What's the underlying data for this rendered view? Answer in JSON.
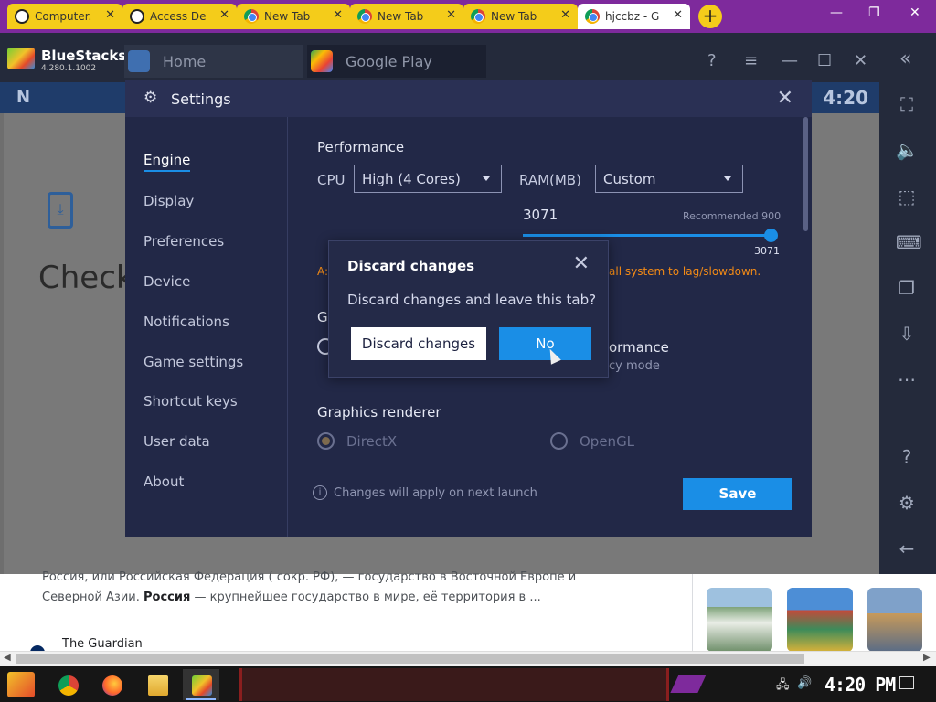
{
  "browser": {
    "tabs": [
      {
        "title": "Computer...",
        "icon": "vpn-icon"
      },
      {
        "title": "Access De",
        "icon": "vpn-icon"
      },
      {
        "title": "New Tab",
        "icon": "chrome-icon"
      },
      {
        "title": "New Tab",
        "icon": "chrome-icon"
      },
      {
        "title": "New Tab",
        "icon": "chrome-icon"
      },
      {
        "title": "hjccbz - G",
        "icon": "chrome-icon",
        "active": true
      }
    ],
    "new_tab": "+",
    "close_glyph": "✕",
    "window_controls": {
      "minimize": "—",
      "restore": "❐",
      "close": "✕"
    }
  },
  "bluestacks": {
    "brand": "BlueStacks",
    "version": "4.280.1.1002",
    "tabs": {
      "home": "Home",
      "google_play": "Google Play"
    },
    "topbar_controls": {
      "help": "?",
      "menu": "≡",
      "minimize": "—",
      "maximize": "☐",
      "close": "✕",
      "collapse": "«"
    }
  },
  "android": {
    "logo": "N",
    "clock": "4:20",
    "heading": "Check"
  },
  "settings": {
    "title": "Settings",
    "close": "✕",
    "nav": [
      "Engine",
      "Display",
      "Preferences",
      "Device",
      "Notifications",
      "Game settings",
      "Shortcut keys",
      "User data",
      "About"
    ],
    "active_nav": "Engine",
    "performance": {
      "title": "Performance",
      "cpu_label": "CPU",
      "cpu_value": "High (4 Cores)",
      "ram_label": "RAM(MB)",
      "ram_value": "Custom",
      "ram_current": "3071",
      "ram_recommended": "Recommended 900",
      "ram_max": "3071",
      "warning_left": "A:",
      "warning_right": "all system to lag/slowdown."
    },
    "graphics": {
      "title_fragment": "G",
      "option_fragment": "ormance",
      "sub_fragment": "cy mode"
    },
    "renderer": {
      "title": "Graphics renderer",
      "options": [
        {
          "label": "DirectX",
          "selected": true
        },
        {
          "label": "OpenGL",
          "selected": false
        }
      ]
    },
    "note": "Changes will apply on next launch",
    "note_icon": "i",
    "save": "Save"
  },
  "discard_dialog": {
    "title": "Discard changes",
    "close": "✕",
    "message": "Discard changes and leave this tab?",
    "discard_button": "Discard changes",
    "no_button": "No"
  },
  "webpage": {
    "text_line1": "Россия, или Российская Федерация ( сокр. РФ), — государство в Восточной Европе и",
    "text_line2_bold": "Россия",
    "text_line2_pre": "Северной Азии. ",
    "text_line2_post": " — крупнейшее государство в мире, её территория в ...",
    "guardian": "The Guardian"
  },
  "taskbar": {
    "apps": [
      "chrome-icon",
      "firefox-icon",
      "file-explorer-icon",
      "bluestacks-icon"
    ],
    "clock": "4:20 PM"
  },
  "colors": {
    "accent": "#1a8ee6",
    "warning": "#f28a16",
    "dialog_bg": "#222847"
  }
}
